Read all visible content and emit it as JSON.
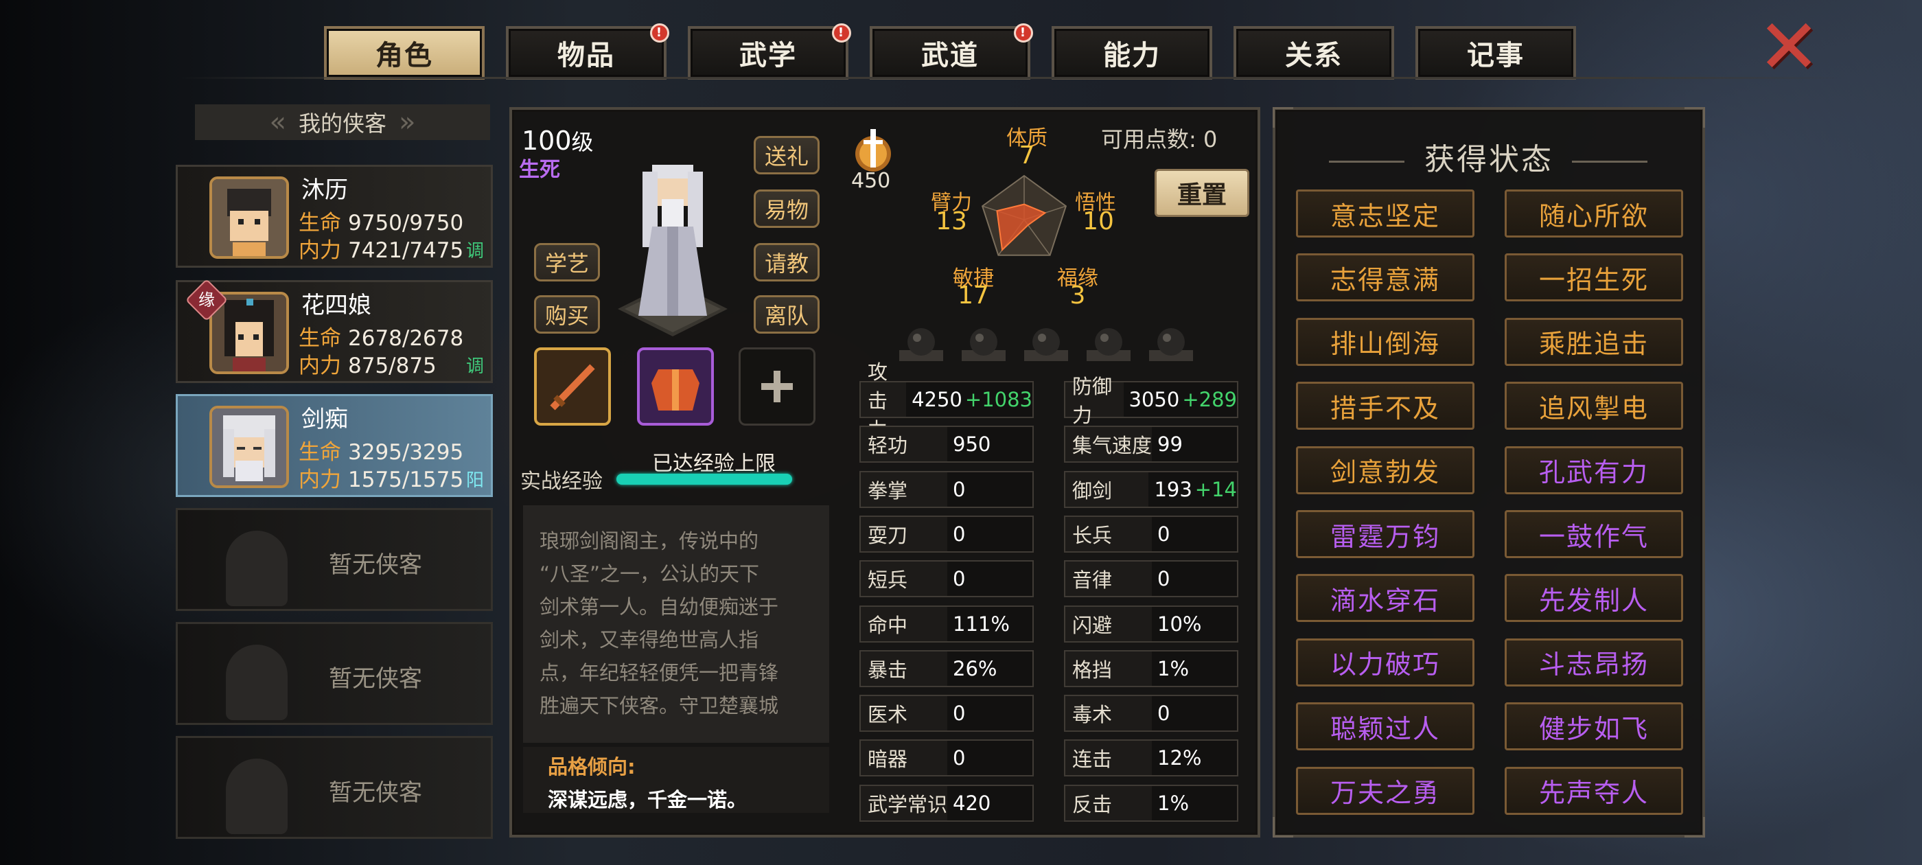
{
  "tabs": [
    {
      "label": "角色",
      "active": true,
      "badge": false
    },
    {
      "label": "物品",
      "active": false,
      "badge": true
    },
    {
      "label": "武学",
      "active": false,
      "badge": true
    },
    {
      "label": "武道",
      "active": false,
      "badge": true
    },
    {
      "label": "能力",
      "active": false,
      "badge": false
    },
    {
      "label": "关系",
      "active": false,
      "badge": false
    },
    {
      "label": "记事",
      "active": false,
      "badge": false
    }
  ],
  "badge_mark": "!",
  "close_glyph": "✕",
  "heroes": {
    "header": "我的侠客",
    "list": [
      {
        "name": "沐历",
        "hp_label": "生命",
        "hp": "9750/9750",
        "mp_label": "内力",
        "mp": "7421/7475",
        "tag": "调"
      },
      {
        "name": "花四娘",
        "hp_label": "生命",
        "hp": "2678/2678",
        "mp_label": "内力",
        "mp": "875/875",
        "tag": "调",
        "fate": "缘"
      },
      {
        "name": "剑痴",
        "hp_label": "生命",
        "hp": "3295/3295",
        "mp_label": "内力",
        "mp": "1575/1575",
        "tag": "阳"
      }
    ],
    "empty": [
      "暂无侠客",
      "暂无侠客",
      "暂无侠客"
    ]
  },
  "char": {
    "level": "100",
    "level_unit": "级",
    "title": "生死",
    "buttons": {
      "gift": "送礼",
      "trade": "易物",
      "learn": "学艺",
      "ask": "请教",
      "buy": "购买",
      "leave": "离队"
    },
    "exp_label": "实战经验",
    "exp_status": "已达经验上限",
    "exp_fraction": 1.0,
    "desc": [
      "琅琊剑阁阁主，传说中的",
      "“八圣”之一，公认的天下",
      "剑术第一人。自幼便痴迷于",
      "剑术，又幸得绝世高人指",
      "点，年纪轻轻便凭一把青锋",
      "胜遍天下侠客。守卫楚襄城"
    ],
    "personality_label": "品格倾向:",
    "personality": "深谋远虑，千金一诺。",
    "power": "450"
  },
  "attrs": {
    "points_label": "可用点数:",
    "points": "0",
    "reset": "重置",
    "items": [
      {
        "label": "体质",
        "value": "7"
      },
      {
        "label": "悟性",
        "value": "10"
      },
      {
        "label": "福缘",
        "value": "3"
      },
      {
        "label": "敏捷",
        "value": "17"
      },
      {
        "label": "臂力",
        "value": "13"
      }
    ]
  },
  "stats_left": [
    {
      "label": "攻击力",
      "value": "4250",
      "bonus": "+1083"
    },
    {
      "label": "轻功",
      "value": "950",
      "bonus": ""
    },
    {
      "label": "拳掌",
      "value": "0",
      "bonus": ""
    },
    {
      "label": "耍刀",
      "value": "0",
      "bonus": ""
    },
    {
      "label": "短兵",
      "value": "0",
      "bonus": ""
    },
    {
      "label": "命中",
      "value": "111%",
      "bonus": ""
    },
    {
      "label": "暴击",
      "value": "26%",
      "bonus": ""
    },
    {
      "label": "医术",
      "value": "0",
      "bonus": ""
    },
    {
      "label": "暗器",
      "value": "0",
      "bonus": ""
    },
    {
      "label": "武学常识",
      "value": "420",
      "bonus": ""
    }
  ],
  "stats_right": [
    {
      "label": "防御力",
      "value": "3050",
      "bonus": "+289"
    },
    {
      "label": "集气速度",
      "value": "99",
      "bonus": ""
    },
    {
      "label": "御剑",
      "value": "193",
      "bonus": "+14"
    },
    {
      "label": "长兵",
      "value": "0",
      "bonus": ""
    },
    {
      "label": "音律",
      "value": "0",
      "bonus": ""
    },
    {
      "label": "闪避",
      "value": "10%",
      "bonus": ""
    },
    {
      "label": "格挡",
      "value": "1%",
      "bonus": ""
    },
    {
      "label": "毒术",
      "value": "0",
      "bonus": ""
    },
    {
      "label": "连击",
      "value": "12%",
      "bonus": ""
    },
    {
      "label": "反击",
      "value": "1%",
      "bonus": ""
    }
  ],
  "statuses": {
    "title": "获得状态",
    "items": [
      {
        "label": "意志坚定",
        "color": "#e9a23b"
      },
      {
        "label": "随心所欲",
        "color": "#e9a23b"
      },
      {
        "label": "志得意满",
        "color": "#e9a23b"
      },
      {
        "label": "一招生死",
        "color": "#e9a23b"
      },
      {
        "label": "排山倒海",
        "color": "#e9a23b"
      },
      {
        "label": "乘胜追击",
        "color": "#e9a23b"
      },
      {
        "label": "措手不及",
        "color": "#e9a23b"
      },
      {
        "label": "追风掣电",
        "color": "#e9a23b"
      },
      {
        "label": "剑意勃发",
        "color": "#e9a23b"
      },
      {
        "label": "孔武有力",
        "color": "#b85ef0"
      },
      {
        "label": "雷霆万钧",
        "color": "#b85ef0"
      },
      {
        "label": "一鼓作气",
        "color": "#b85ef0"
      },
      {
        "label": "滴水穿石",
        "color": "#b85ef0"
      },
      {
        "label": "先发制人",
        "color": "#b85ef0"
      },
      {
        "label": "以力破巧",
        "color": "#b85ef0"
      },
      {
        "label": "斗志昂扬",
        "color": "#b85ef0"
      },
      {
        "label": "聪颖过人",
        "color": "#b85ef0"
      },
      {
        "label": "健步如飞",
        "color": "#b85ef0"
      },
      {
        "label": "万夫之勇",
        "color": "#b85ef0"
      },
      {
        "label": "先声夺人",
        "color": "#b85ef0"
      }
    ]
  },
  "colors": {
    "orange": "#f0a53a",
    "purple": "#b96cf0",
    "green": "#43d36b",
    "gold": "#f5c440"
  }
}
